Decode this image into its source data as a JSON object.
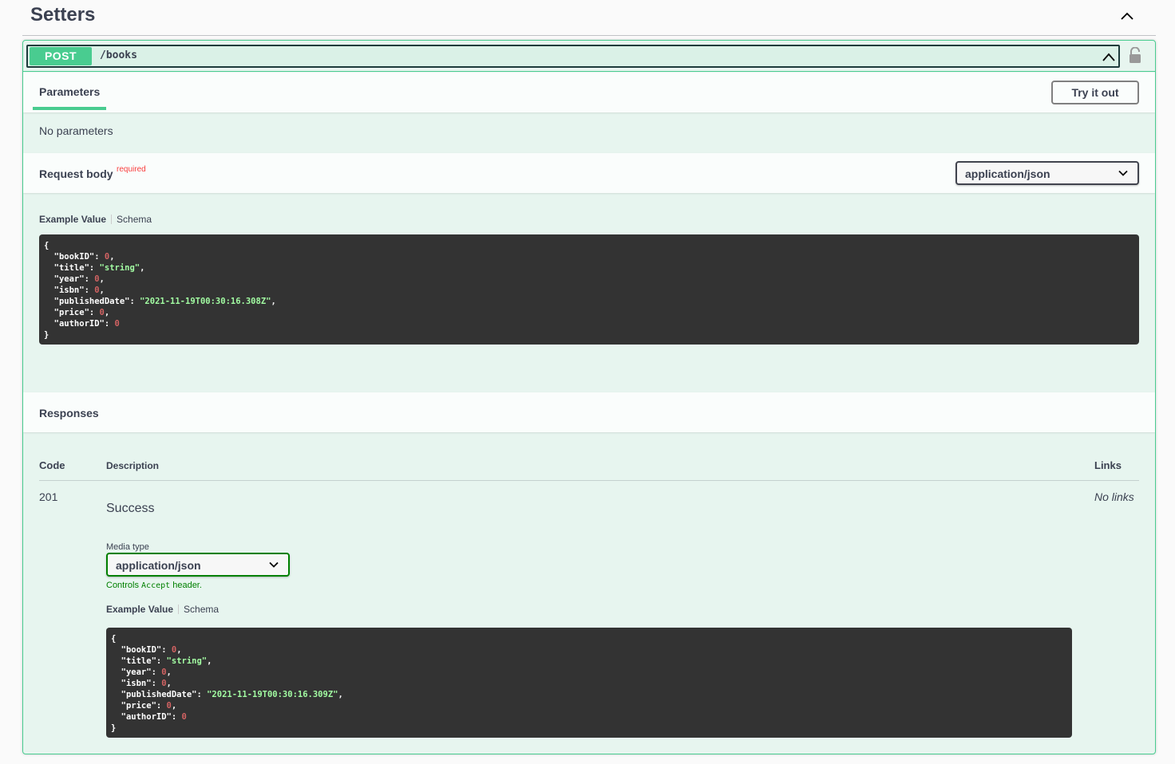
{
  "tag": {
    "title": "Setters"
  },
  "operation": {
    "method": "POST",
    "path": "/books"
  },
  "parameters": {
    "tab_label": "Parameters",
    "try_button": "Try it out",
    "empty_text": "No parameters"
  },
  "request_body": {
    "title": "Request body",
    "required_label": "required",
    "content_type": "application/json",
    "example_tab": "Example Value",
    "schema_tab": "Schema",
    "example": {
      "open": "{",
      "close": "}",
      "fields": [
        {
          "key": "\"bookID\"",
          "value": "0",
          "kind": "number",
          "comma": ","
        },
        {
          "key": "\"title\"",
          "value": "\"string\"",
          "kind": "string",
          "comma": ","
        },
        {
          "key": "\"year\"",
          "value": "0",
          "kind": "number",
          "comma": ","
        },
        {
          "key": "\"isbn\"",
          "value": "0",
          "kind": "number",
          "comma": ","
        },
        {
          "key": "\"publishedDate\"",
          "value": "\"2021-11-19T00:30:16.308Z\"",
          "kind": "string",
          "comma": ","
        },
        {
          "key": "\"price\"",
          "value": "0",
          "kind": "number",
          "comma": ","
        },
        {
          "key": "\"authorID\"",
          "value": "0",
          "kind": "number",
          "comma": ""
        }
      ]
    }
  },
  "responses": {
    "title": "Responses",
    "headers": {
      "code": "Code",
      "description": "Description",
      "links": "Links"
    },
    "rows": [
      {
        "code": "201",
        "description": "Success",
        "links": "No links",
        "media_type_label": "Media type",
        "media_type": "application/json",
        "controls_prefix": "Controls",
        "controls_code": "Accept",
        "controls_suffix": "header.",
        "example_tab": "Example Value",
        "schema_tab": "Schema",
        "example": {
          "open": "{",
          "close": "}",
          "fields": [
            {
              "key": "\"bookID\"",
              "value": "0",
              "kind": "number",
              "comma": ","
            },
            {
              "key": "\"title\"",
              "value": "\"string\"",
              "kind": "string",
              "comma": ","
            },
            {
              "key": "\"year\"",
              "value": "0",
              "kind": "number",
              "comma": ","
            },
            {
              "key": "\"isbn\"",
              "value": "0",
              "kind": "number",
              "comma": ","
            },
            {
              "key": "\"publishedDate\"",
              "value": "\"2021-11-19T00:30:16.309Z\"",
              "kind": "string",
              "comma": ","
            },
            {
              "key": "\"price\"",
              "value": "0",
              "kind": "number",
              "comma": ","
            },
            {
              "key": "\"authorID\"",
              "value": "0",
              "kind": "number",
              "comma": ""
            }
          ]
        }
      }
    ]
  },
  "icons": {
    "tag_collapse": "chevron-up-icon",
    "summary_collapse": "chevron-up-icon",
    "lock": "unlocked-icon",
    "select_arrow": "chevron-down-icon"
  },
  "colors": {
    "post": "#49cc90",
    "code_bg": "#333333",
    "string": "#a2fca2",
    "number": "#d36363",
    "required": "#f93e3e",
    "controls": "#008000"
  }
}
